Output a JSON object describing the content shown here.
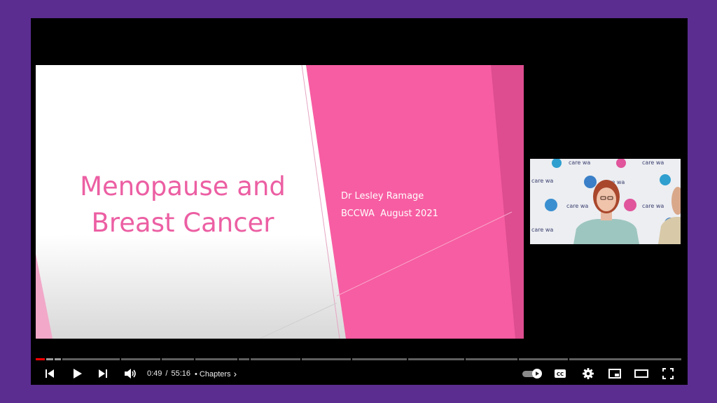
{
  "video": {
    "slide": {
      "title_line1": "Menopause and",
      "title_line2": "Breast Cancer",
      "presenter": "Dr Lesley Ramage",
      "event": "BCCWA  August 2021"
    },
    "webcam": {
      "backdrop_text": "breast cancer care wa"
    }
  },
  "player": {
    "current_time": "0:49",
    "separator": "/",
    "duration": "55:16",
    "chapters_label": "• Chapters",
    "chapters_chevron": "›",
    "progress_fraction": 0.0148,
    "buffered_fraction": 0.04,
    "colors": {
      "progress_played": "#ff0000",
      "slide_pink": "#f75da2",
      "title_pink": "#ec5fa3",
      "page_background": "#5c2d91"
    },
    "icons": [
      "previous-icon",
      "play-icon",
      "next-icon",
      "volume-icon",
      "autoplay-toggle",
      "captions-icon",
      "settings-gear-icon",
      "miniplayer-icon",
      "theater-mode-icon",
      "fullscreen-icon"
    ]
  }
}
